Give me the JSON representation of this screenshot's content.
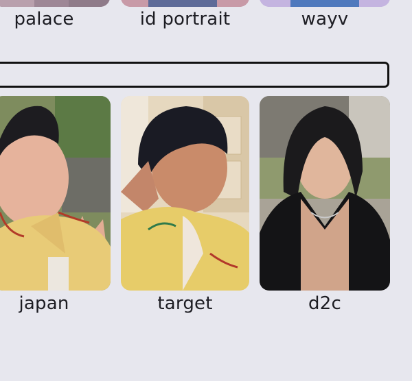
{
  "top_row": [
    {
      "label": "palace",
      "photo_color": "#a98f9c"
    },
    {
      "label": "id portrait",
      "photo_color": "#b98a98"
    },
    {
      "label": "wayv",
      "photo_color": "#b7a6d6"
    }
  ],
  "search": {
    "placeholder": "",
    "value": ""
  },
  "photocards": [
    {
      "label": "japan"
    },
    {
      "label": "target"
    },
    {
      "label": "d2c"
    }
  ]
}
